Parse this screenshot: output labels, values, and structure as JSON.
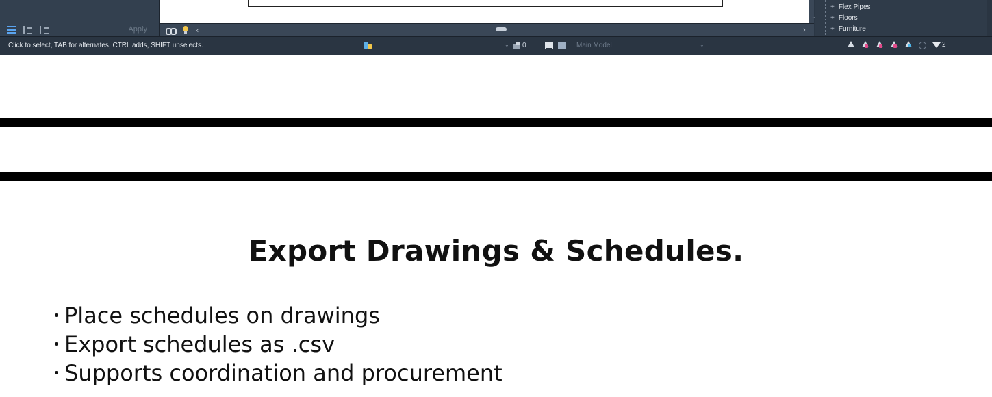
{
  "revit": {
    "properties": {
      "apply_label": "Apply"
    },
    "project_browser": {
      "items": [
        {
          "label": "Flex Pipes"
        },
        {
          "label": "Floors"
        },
        {
          "label": "Furniture"
        }
      ]
    },
    "status_bar": {
      "message": "Click to select, TAB for alternates, CTRL adds, SHIFT unselects.",
      "design_options_count": "0",
      "active_model": "Main Model",
      "filter_count": "2"
    }
  },
  "slide": {
    "heading": "Export Drawings & Schedules.",
    "bullets": [
      "Place schedules on drawings",
      "Export schedules as .csv",
      "Supports coordination and procurement"
    ]
  },
  "colors": {
    "ui_background": "#2b3745",
    "status_bar": "#2a3542",
    "accent_blue": "#5aa4f0",
    "band": "#000000",
    "text_dark": "#111111"
  }
}
